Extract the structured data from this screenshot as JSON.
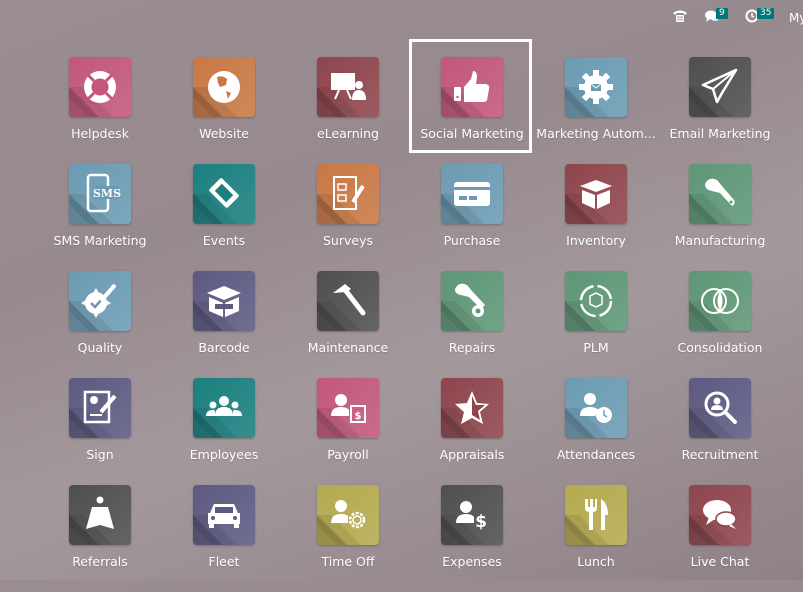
{
  "systray": {
    "phone_icon": "phone-icon",
    "messages_icon": "chat-icon",
    "messages_count": "9",
    "activities_icon": "clock-icon",
    "activities_count": "35",
    "user_label": "My"
  },
  "selected_app": "Social Marketing",
  "apps": [
    {
      "label": "Helpdesk",
      "icon": "lifebuoy-icon",
      "color": "#c2577a"
    },
    {
      "label": "Website",
      "icon": "globe-icon",
      "color": "#c87845"
    },
    {
      "label": "eLearning",
      "icon": "presentation-icon",
      "color": "#8e454c"
    },
    {
      "label": "Social Marketing",
      "icon": "thumbs-up-icon",
      "color": "#c2577a"
    },
    {
      "label": "Marketing Autom...",
      "icon": "gear-envelope-icon",
      "color": "#6b9bb3"
    },
    {
      "label": "Email Marketing",
      "icon": "paper-plane-icon",
      "color": "#4f4f4f"
    },
    {
      "label": "SMS Marketing",
      "icon": "sms-phone-icon",
      "color": "#6b9bb3"
    },
    {
      "label": "Events",
      "icon": "ticket-icon",
      "color": "#1b7f7f"
    },
    {
      "label": "Surveys",
      "icon": "checklist-pencil-icon",
      "color": "#c87845"
    },
    {
      "label": "Purchase",
      "icon": "credit-card-icon",
      "color": "#6b9bb3"
    },
    {
      "label": "Inventory",
      "icon": "open-box-icon",
      "color": "#8e454c"
    },
    {
      "label": "Manufacturing",
      "icon": "wrench-icon",
      "color": "#5e9677"
    },
    {
      "label": "Quality",
      "icon": "badge-pencil-icon",
      "color": "#6b9bb3"
    },
    {
      "label": "Barcode",
      "icon": "barcode-box-icon",
      "color": "#5d5a82"
    },
    {
      "label": "Maintenance",
      "icon": "hammer-icon",
      "color": "#4f4f4f"
    },
    {
      "label": "Repairs",
      "icon": "wrench-gear-icon",
      "color": "#5e9677"
    },
    {
      "label": "PLM",
      "icon": "cycle-box-icon",
      "color": "#5e9677"
    },
    {
      "label": "Consolidation",
      "icon": "venn-icon",
      "color": "#5e9677"
    },
    {
      "label": "Sign",
      "icon": "document-sign-icon",
      "color": "#5d5a82"
    },
    {
      "label": "Employees",
      "icon": "people-icon",
      "color": "#1b7f7f"
    },
    {
      "label": "Payroll",
      "icon": "person-calendar-dollar-icon",
      "color": "#c2577a"
    },
    {
      "label": "Appraisals",
      "icon": "half-star-icon",
      "color": "#8e454c"
    },
    {
      "label": "Attendances",
      "icon": "person-clock-icon",
      "color": "#6b9bb3"
    },
    {
      "label": "Recruitment",
      "icon": "person-search-icon",
      "color": "#5d5a82"
    },
    {
      "label": "Referrals",
      "icon": "hero-icon",
      "color": "#4f4f4f"
    },
    {
      "label": "Fleet",
      "icon": "car-icon",
      "color": "#5d5a82"
    },
    {
      "label": "Time Off",
      "icon": "person-sun-icon",
      "color": "#b5a94f"
    },
    {
      "label": "Expenses",
      "icon": "person-dollar-icon",
      "color": "#4f4f4f"
    },
    {
      "label": "Lunch",
      "icon": "fork-knife-icon",
      "color": "#b5a94f"
    },
    {
      "label": "Live Chat",
      "icon": "chat-bubbles-icon",
      "color": "#8e454c"
    }
  ]
}
